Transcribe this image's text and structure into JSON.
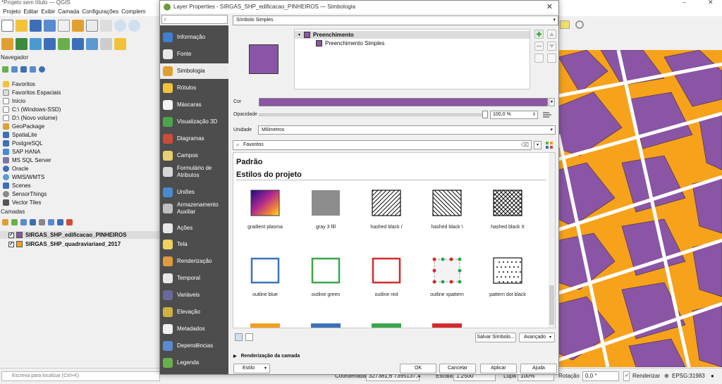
{
  "qgis": {
    "title": "*Projeto sem título — QGIS",
    "menu": [
      "Projeto",
      "Editar",
      "Exibir",
      "Camada",
      "Configurações",
      "Complem"
    ],
    "navigator": {
      "title": "Navegador",
      "items": [
        "Favoritos",
        "Favoritos Espaciais",
        "Início",
        "C:\\ (Windows-SSD)",
        "D:\\ (Novo volume)",
        "GeoPackage",
        "SpatiaLite",
        "PostgreSQL",
        "SAP HANA",
        "MS SQL Server",
        "Oracle",
        "WMS/WMTS",
        "Scenes",
        "SensorThings",
        "Vector Tiles"
      ]
    },
    "layers": {
      "title": "Camadas",
      "items": [
        {
          "name": "SIRGAS_SHP_edificacao_PINHEIROS",
          "color": "#8a55a5",
          "checked": "✓"
        },
        {
          "name": "SIRGAS_SHP_quadraviariaed_2017",
          "color": "#f7a21b",
          "checked": "✓"
        }
      ]
    },
    "status": {
      "locator_placeholder": "Escreva para localizar (Ctrl+K)",
      "coord_label": "Coordenada",
      "coord_value": "327381,6  7395137,4",
      "scale_label": "Escala",
      "scale_value": "1:2500",
      "zoom_label": "Lupa",
      "zoom_value": "100%",
      "rotation_label": "Rotação",
      "rotation_value": "0,0 °",
      "render_label": "Renderizar",
      "crs": "EPSG:31983"
    }
  },
  "dialog": {
    "title": "Layer Properties - SIRGAS_SHP_edificacao_PINHEIROS — Simbologia",
    "sidebar": [
      {
        "label": "Informação",
        "color": "#3d7fd0"
      },
      {
        "label": "Fonte",
        "color": "#e8e8e8"
      },
      {
        "label": "Simbologia",
        "color": "#e0a030"
      },
      {
        "label": "Rótulos",
        "color": "#f2c23a"
      },
      {
        "label": "Máscaras",
        "color": "#f2f2f2"
      },
      {
        "label": "Visualização 3D",
        "color": "#4aa64a"
      },
      {
        "label": "Diagramas",
        "color": "#d04a3a"
      },
      {
        "label": "Campos",
        "color": "#e8d070"
      },
      {
        "label": "Formulário de Atributos",
        "color": "#d8d8d8"
      },
      {
        "label": "Uniões",
        "color": "#4a8ad0"
      },
      {
        "label": "Armazenamento Auxiliar",
        "color": "#c0c0c0"
      },
      {
        "label": "Ações",
        "color": "#e8e8e8"
      },
      {
        "label": "Tela",
        "color": "#f2d060"
      },
      {
        "label": "Renderização",
        "color": "#e09a40"
      },
      {
        "label": "Temporal",
        "color": "#e8e8e8"
      },
      {
        "label": "Variáveis",
        "color": "#6a6a9a"
      },
      {
        "label": "Elevação",
        "color": "#d0b040"
      },
      {
        "label": "Metadados",
        "color": "#f0f0f0"
      },
      {
        "label": "Dependências",
        "color": "#5a8ad0"
      },
      {
        "label": "Legenda",
        "color": "#6ab04a"
      }
    ],
    "renderer": "Símbolo Simples",
    "tree": {
      "parent": "Preenchimento",
      "child": "Preenchimento Simples",
      "fill_color": "#8a55a5"
    },
    "color_label": "Cor",
    "color_value": "#8a55a5",
    "opacity_label": "Opacidade",
    "opacity_value": "100,0 %",
    "opacity_fraction": 1.0,
    "units_label": "Unidade",
    "units_value": "Milímetros",
    "search_value": "Favoritos",
    "gallery": {
      "section_default": "Padrão",
      "section_project": "Estilos do projeto",
      "row1": [
        {
          "label": "gradient  plasma",
          "kind": "gradient"
        },
        {
          "label": "gray 3 fill",
          "kind": "gray"
        },
        {
          "label": "hashed black /",
          "kind": "hash-fwd"
        },
        {
          "label": "hashed black \\",
          "kind": "hash-back"
        },
        {
          "label": "hashed black X",
          "kind": "hash-x"
        }
      ],
      "row2": [
        {
          "label": "outline blue",
          "kind": "outline",
          "color": "#3a72b8"
        },
        {
          "label": "outline green",
          "kind": "outline",
          "color": "#3aa64a"
        },
        {
          "label": "outline red",
          "kind": "outline",
          "color": "#d42a2a"
        },
        {
          "label": "outline xpattern",
          "kind": "xpattern"
        },
        {
          "label": "pattern dot black",
          "kind": "dots"
        }
      ]
    },
    "buttons": {
      "save_symbol": "Salvar Símbolo...",
      "advanced": "Avançado",
      "layer_rendering": "Renderização da camada",
      "style": "Estilo",
      "ok": "OK",
      "cancel": "Cancelar",
      "apply": "Aplicar",
      "help": "Ajuda"
    }
  }
}
